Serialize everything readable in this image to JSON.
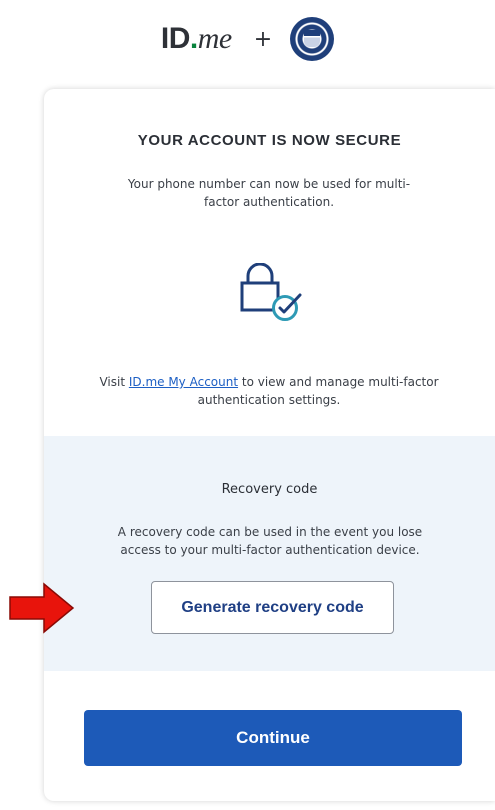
{
  "header": {
    "logo_id": "ID",
    "logo_dot": ".",
    "logo_me": "me",
    "plus": "+",
    "partner_seal": "ssa-seal-icon"
  },
  "card": {
    "title": "YOUR ACCOUNT IS NOW SECURE",
    "description": "Your phone number can now be used for multi-factor authentication.",
    "icon": "lock-check-icon",
    "visit_prefix": "Visit ",
    "visit_link": "ID.me My Account",
    "visit_suffix": " to view and manage multi-factor authentication settings."
  },
  "recovery": {
    "title": "Recovery code",
    "description": "A recovery code can be used in the event you lose access to your multi-factor authentication device.",
    "button_label": "Generate recovery code"
  },
  "continue_label": "Continue",
  "colors": {
    "primary": "#1d5ab8",
    "link": "#1d5fc4",
    "recovery_bg": "#eef4fa",
    "check_teal": "#2e9ab5",
    "pointer_red": "#e8140c"
  }
}
